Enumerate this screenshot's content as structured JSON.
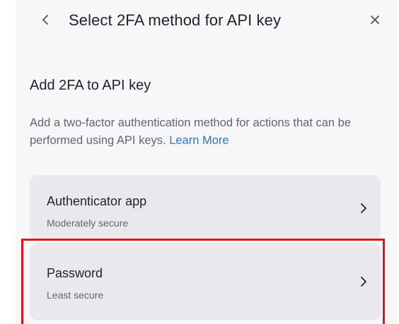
{
  "header": {
    "title": "Select 2FA method for API key",
    "back_icon": "chevron-left-icon",
    "close_icon": "close-icon"
  },
  "section": {
    "title": "Add 2FA to API key",
    "description": "Add a two-factor authentication method for actions that can be performed using API keys.",
    "link_text": "Learn More"
  },
  "options": [
    {
      "title": "Authenticator app",
      "subtitle": "Moderately secure",
      "icon": "chevron-right-icon"
    },
    {
      "title": "Password",
      "subtitle": "Least secure",
      "icon": "chevron-right-icon"
    }
  ],
  "colors": {
    "text": "#1e2329",
    "muted": "#5e6673",
    "link": "#3375bb",
    "card": "#e9e9ed",
    "highlight": "#e2131a"
  }
}
